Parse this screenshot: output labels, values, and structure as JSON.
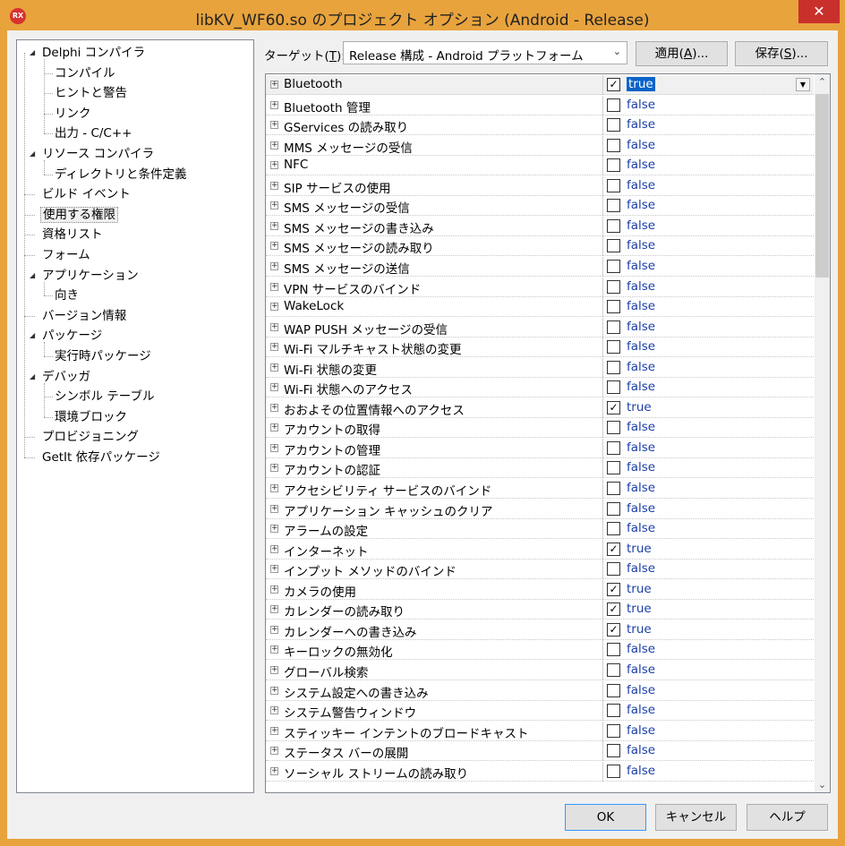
{
  "window": {
    "title": "libKV_WF60.so のプロジェクト オプション  (Android - Release)",
    "icon_text": "RX",
    "close_label": "✕",
    "accent_color": "#e8a33d"
  },
  "tree": {
    "items": [
      {
        "label": "Delphi コンパイラ",
        "level": 0,
        "expander": "◢"
      },
      {
        "label": "コンパイル",
        "level": 1
      },
      {
        "label": "ヒントと警告",
        "level": 1
      },
      {
        "label": "リンク",
        "level": 1
      },
      {
        "label": "出力 - C/C++",
        "level": 1
      },
      {
        "label": "リソース コンパイラ",
        "level": 0,
        "expander": "◢"
      },
      {
        "label": "ディレクトリと条件定義",
        "level": 1
      },
      {
        "label": "ビルド イベント",
        "level": 0
      },
      {
        "label": "使用する権限",
        "level": 0,
        "selected": true
      },
      {
        "label": "資格リスト",
        "level": 0
      },
      {
        "label": "フォーム",
        "level": 0
      },
      {
        "label": "アプリケーション",
        "level": 0,
        "expander": "◢"
      },
      {
        "label": "向き",
        "level": 1
      },
      {
        "label": "バージョン情報",
        "level": 0
      },
      {
        "label": "パッケージ",
        "level": 0,
        "expander": "◢"
      },
      {
        "label": "実行時パッケージ",
        "level": 1
      },
      {
        "label": "デバッガ",
        "level": 0,
        "expander": "◢"
      },
      {
        "label": "シンボル テーブル",
        "level": 1
      },
      {
        "label": "環境ブロック",
        "level": 1
      },
      {
        "label": "プロビジョニング",
        "level": 0
      },
      {
        "label": "GetIt 依存パッケージ",
        "level": 0
      }
    ]
  },
  "target": {
    "label_prefix": "ターゲット(",
    "label_key": "T",
    "label_suffix": "):",
    "selected": "Release 構成 - Android プラットフォーム",
    "apply_prefix": "適用(",
    "apply_key": "A",
    "apply_suffix": ")...",
    "save_prefix": "保存(",
    "save_key": "S",
    "save_suffix": ")..."
  },
  "permissions": [
    {
      "name": "Bluetooth",
      "value": "true",
      "checked": true,
      "selected": true
    },
    {
      "name": "Bluetooth 管理",
      "value": "false",
      "checked": false
    },
    {
      "name": "GServices の読み取り",
      "value": "false",
      "checked": false
    },
    {
      "name": "MMS メッセージの受信",
      "value": "false",
      "checked": false
    },
    {
      "name": "NFC",
      "value": "false",
      "checked": false
    },
    {
      "name": "SIP サービスの使用",
      "value": "false",
      "checked": false
    },
    {
      "name": "SMS メッセージの受信",
      "value": "false",
      "checked": false
    },
    {
      "name": "SMS メッセージの書き込み",
      "value": "false",
      "checked": false
    },
    {
      "name": "SMS メッセージの読み取り",
      "value": "false",
      "checked": false
    },
    {
      "name": "SMS メッセージの送信",
      "value": "false",
      "checked": false
    },
    {
      "name": "VPN サービスのバインド",
      "value": "false",
      "checked": false
    },
    {
      "name": "WakeLock",
      "value": "false",
      "checked": false
    },
    {
      "name": "WAP PUSH メッセージの受信",
      "value": "false",
      "checked": false
    },
    {
      "name": "Wi-Fi マルチキャスト状態の変更",
      "value": "false",
      "checked": false
    },
    {
      "name": "Wi-Fi 状態の変更",
      "value": "false",
      "checked": false
    },
    {
      "name": "Wi-Fi 状態へのアクセス",
      "value": "false",
      "checked": false
    },
    {
      "name": "おおよその位置情報へのアクセス",
      "value": "true",
      "checked": true
    },
    {
      "name": "アカウントの取得",
      "value": "false",
      "checked": false
    },
    {
      "name": "アカウントの管理",
      "value": "false",
      "checked": false
    },
    {
      "name": "アカウントの認証",
      "value": "false",
      "checked": false
    },
    {
      "name": "アクセシビリティ サービスのバインド",
      "value": "false",
      "checked": false
    },
    {
      "name": "アプリケーション キャッシュのクリア",
      "value": "false",
      "checked": false
    },
    {
      "name": "アラームの設定",
      "value": "false",
      "checked": false
    },
    {
      "name": "インターネット",
      "value": "true",
      "checked": true
    },
    {
      "name": "インプット メソッドのバインド",
      "value": "false",
      "checked": false
    },
    {
      "name": "カメラの使用",
      "value": "true",
      "checked": true
    },
    {
      "name": "カレンダーの読み取り",
      "value": "true",
      "checked": true
    },
    {
      "name": "カレンダーへの書き込み",
      "value": "true",
      "checked": true
    },
    {
      "name": "キーロックの無効化",
      "value": "false",
      "checked": false
    },
    {
      "name": "グローバル検索",
      "value": "false",
      "checked": false
    },
    {
      "name": "システム設定への書き込み",
      "value": "false",
      "checked": false
    },
    {
      "name": "システム警告ウィンドウ",
      "value": "false",
      "checked": false
    },
    {
      "name": "スティッキー インテントのブロードキャスト",
      "value": "false",
      "checked": false
    },
    {
      "name": "ステータス バーの展開",
      "value": "false",
      "checked": false
    },
    {
      "name": "ソーシャル ストリームの読み取り",
      "value": "false",
      "checked": false
    }
  ],
  "footer": {
    "ok_label": "OK",
    "cancel_label": "キャンセル",
    "help_label": "ヘルプ"
  }
}
